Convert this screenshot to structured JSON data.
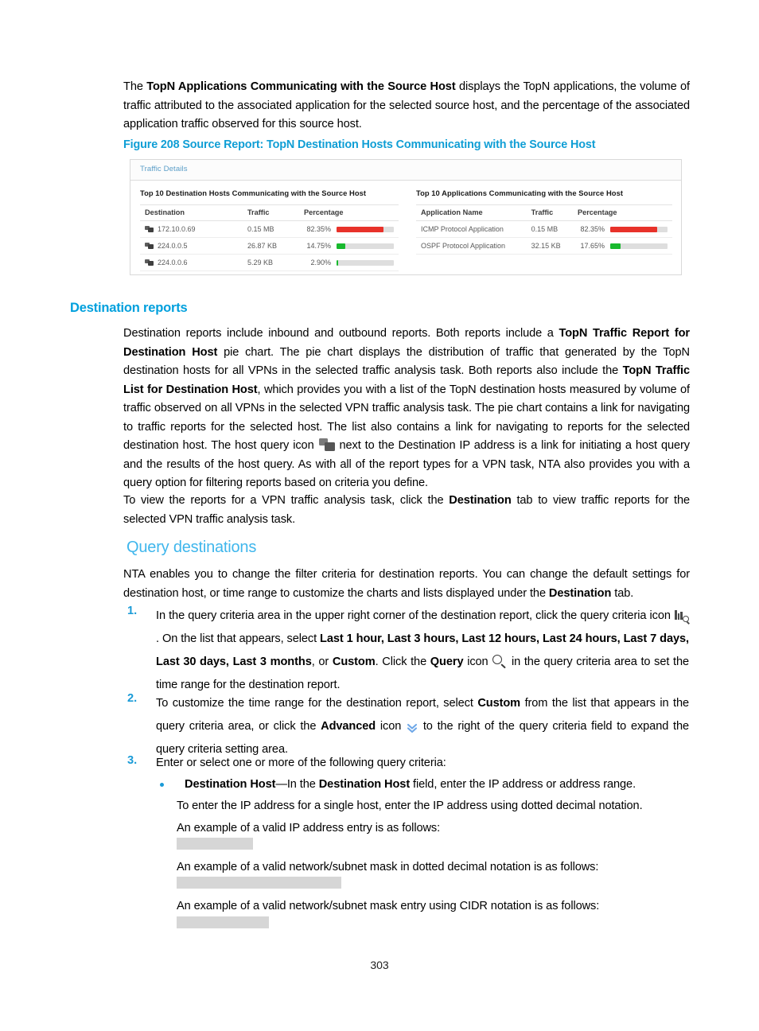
{
  "page": {
    "number": "303"
  },
  "intro": {
    "p1_before": "The ",
    "p1_bold": "TopN Applications Communicating with the Source Host",
    "p1_after": " displays the TopN applications, the volume of traffic attributed to the associated application for the selected source host, and the percentage of the associated application traffic observed for this source host."
  },
  "figure": {
    "caption": "Figure 208 Source Report: TopN Destination Hosts Communicating with the Source Host",
    "tab_label": "Traffic Details",
    "left_panel": {
      "title": "Top 10 Destination Hosts Communicating with the Source Host",
      "columns": [
        "Destination",
        "Traffic",
        "Percentage"
      ],
      "rows": [
        {
          "name": "172.10.0.69",
          "traffic": "0.15 MB",
          "percent_label": "82.35%",
          "percent_value": 82.35,
          "bar_color": "#e8322a"
        },
        {
          "name": "224.0.0.5",
          "traffic": "26.87 KB",
          "percent_label": "14.75%",
          "percent_value": 14.75,
          "bar_color": "#18b92e"
        },
        {
          "name": "224.0.0.6",
          "traffic": "5.29 KB",
          "percent_label": "2.90%",
          "percent_value": 2.9,
          "bar_color": "#18b92e"
        }
      ]
    },
    "right_panel": {
      "title": "Top 10 Applications Communicating with the Source Host",
      "columns": [
        "Application Name",
        "Traffic",
        "Percentage"
      ],
      "rows": [
        {
          "name": "ICMP Protocol Application",
          "traffic": "0.15 MB",
          "percent_label": "82.35%",
          "percent_value": 82.35,
          "bar_color": "#e8322a"
        },
        {
          "name": "OSPF Protocol Application",
          "traffic": "32.15 KB",
          "percent_label": "17.65%",
          "percent_value": 17.65,
          "bar_color": "#18b92e"
        }
      ]
    }
  },
  "destination_reports": {
    "heading": "Destination reports",
    "p1_a": "Destination reports include inbound and outbound reports. Both reports include a ",
    "p1_b1": "TopN Traffic Report for Destination Host",
    "p1_c": " pie chart. The pie chart displays the distribution of traffic that generated by the TopN destination hosts for all VPNs in the selected traffic analysis task. Both reports also include the ",
    "p1_b2": "TopN Traffic List for Destination Host",
    "p1_d": ", which provides you with a list of the TopN destination hosts measured by volume of traffic observed on all VPNs in the selected VPN traffic analysis task. The pie chart contains a link for navigating to traffic reports for the selected host. The list also contains a link for navigating to reports for the selected destination host. The host query icon ",
    "p1_e": " next to the Destination IP address is a link for initiating a host query and the results of the host query. As with all of the report types for a VPN task, NTA also provides you with a query option for filtering reports based on criteria you define.",
    "p2_a": "To view the reports for a VPN traffic analysis task, click the ",
    "p2_b": "Destination",
    "p2_c": " tab to view traffic reports for the selected VPN traffic analysis task."
  },
  "query_destinations": {
    "heading": "Query destinations",
    "intro_a": "NTA enables you to change the filter criteria for destination reports. You can change the default settings for destination host, or time range to customize the charts and lists displayed under the ",
    "intro_b": "Destination",
    "intro_c": " tab.",
    "steps": [
      {
        "number": "1.",
        "a": "In the query criteria area in the upper right corner of the destination report, click the query criteria icon ",
        "b": ". On the list that appears, select ",
        "options_bold": "Last 1 hour, Last 3 hours, Last 12 hours, Last 24 hours, Last 7 days, Last 30 days, Last 3 months",
        "c": ", or ",
        "custom_bold": "Custom",
        "d": ". Click the ",
        "query_bold": "Query",
        "e": " icon ",
        "f": " in the query criteria area to set the time range for the destination report."
      },
      {
        "number": "2.",
        "a": "To customize the time range for the destination report, select ",
        "custom_bold": "Custom",
        "b": " from the list that appears in the query criteria area, or click the ",
        "advanced_bold": "Advanced",
        "c": " icon ",
        "d": " to the right of the query criteria field to expand the query criteria setting area."
      },
      {
        "number": "3.",
        "a": "Enter or select one or more of the following query criteria:"
      }
    ],
    "bullet": {
      "b1": "Destination Host",
      "dash": "—In the ",
      "b2": "Destination Host",
      "rest": " field, enter the IP address or address range.",
      "line2": "To enter the IP address for a single host, enter the IP address using dotted decimal notation.",
      "line3": "An example of a valid IP address entry is as follows:",
      "line4": "An example of a valid network/subnet mask in dotted decimal notation is as follows:",
      "line5": "An example of a valid network/subnet mask entry using CIDR notation is as follows:"
    }
  },
  "colors": {
    "heading_blue": "#00a0dd",
    "subheading_blue": "#3fb6ec",
    "caption_blue": "#0f9ed5",
    "list_marker_blue": "#1a9bd7",
    "bar_red": "#e8322a",
    "bar_green": "#18b92e",
    "redact_gray": "#d6d6d6"
  }
}
